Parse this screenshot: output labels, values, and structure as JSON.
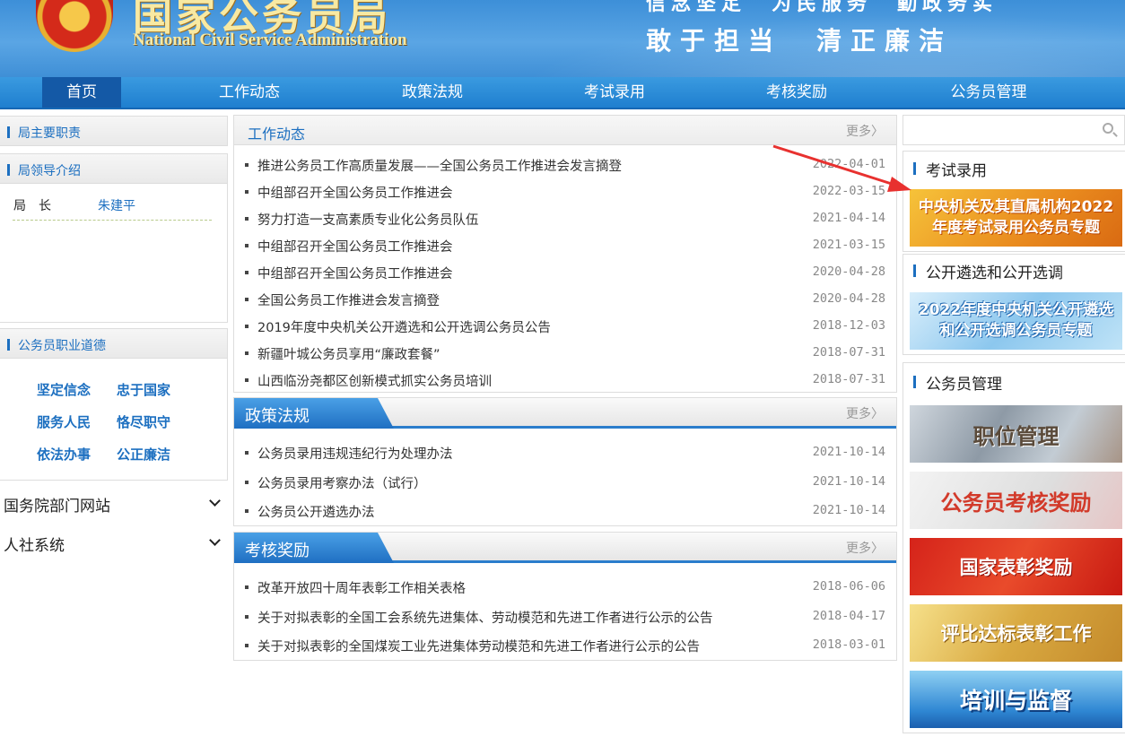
{
  "header": {
    "title_cn": "国家公务员局",
    "title_en": "National Civil Service Administration",
    "slogan_top": "信念坚定　为民服务　勤政务实",
    "slogan_bottom": "敢于担当　清正廉洁"
  },
  "nav": [
    "首页",
    "工作动态",
    "政策法规",
    "考试录用",
    "考核奖励",
    "公务员管理"
  ],
  "left": {
    "duties": "局主要职责",
    "leaders": "局领导介绍",
    "director_label": "局　长",
    "director_name": "朱建平",
    "ethics_title": "公务员职业道德",
    "ethics": [
      "坚定信念",
      "忠于国家",
      "服务人民",
      "恪尽职守",
      "依法办事",
      "公正廉洁"
    ],
    "select1": "国务院部门网站",
    "select2": "人社系统"
  },
  "work": {
    "title": "工作动态",
    "more": "更多",
    "items": [
      {
        "title": "推进公务员工作高质量发展——全国公务员工作推进会发言摘登",
        "date": "2022-04-01"
      },
      {
        "title": "中组部召开全国公务员工作推进会",
        "date": "2022-03-15"
      },
      {
        "title": "努力打造一支高素质专业化公务员队伍",
        "date": "2021-04-14"
      },
      {
        "title": "中组部召开全国公务员工作推进会",
        "date": "2021-03-15"
      },
      {
        "title": "中组部召开全国公务员工作推进会",
        "date": "2020-04-28"
      },
      {
        "title": "全国公务员工作推进会发言摘登",
        "date": "2020-04-28"
      },
      {
        "title": "2019年度中央机关公开遴选和公开选调公务员公告",
        "date": "2018-12-03"
      },
      {
        "title": "新疆叶城公务员享用“廉政套餐”",
        "date": "2018-07-31"
      },
      {
        "title": "山西临汾尧都区创新模式抓实公务员培训",
        "date": "2018-07-31"
      }
    ]
  },
  "policy": {
    "title": "政策法规",
    "more": "更多",
    "items": [
      {
        "title": "公务员录用违规违纪行为处理办法",
        "date": "2021-10-14"
      },
      {
        "title": "公务员录用考察办法（试行）",
        "date": "2021-10-14"
      },
      {
        "title": "公务员公开遴选办法",
        "date": "2021-10-14"
      }
    ]
  },
  "award": {
    "title": "考核奖励",
    "more": "更多",
    "items": [
      {
        "title": "改革开放四十周年表彰工作相关表格",
        "date": "2018-06-06"
      },
      {
        "title": "关于对拟表彰的全国工会系统先进集体、劳动模范和先进工作者进行公示的公告",
        "date": "2018-04-17"
      },
      {
        "title": "关于对拟表彰的全国煤炭工业先进集体劳动模范和先进工作者进行公示的公告",
        "date": "2018-03-01"
      }
    ]
  },
  "right": {
    "search_placeholder": "",
    "exam_title": "考试录用",
    "exam_banner_line1": "中央机关及其直属机构2022",
    "exam_banner_line2": "年度考试录用公务员专题",
    "select_title": "公开遴选和公开选调",
    "select_banner_line1": "2022年度中央机关公开遴选",
    "select_banner_line2": "和公开选调公务员专题",
    "manage_title": "公务员管理",
    "manage_banners": [
      "职位管理",
      "公务员考核奖励",
      "国家表彰奖励",
      "评比达标表彰工作",
      "培训与监督"
    ]
  },
  "colors": {
    "accent": "#1c6fc0",
    "nav": "#1f7fcf",
    "arrow": "#e8312f"
  }
}
